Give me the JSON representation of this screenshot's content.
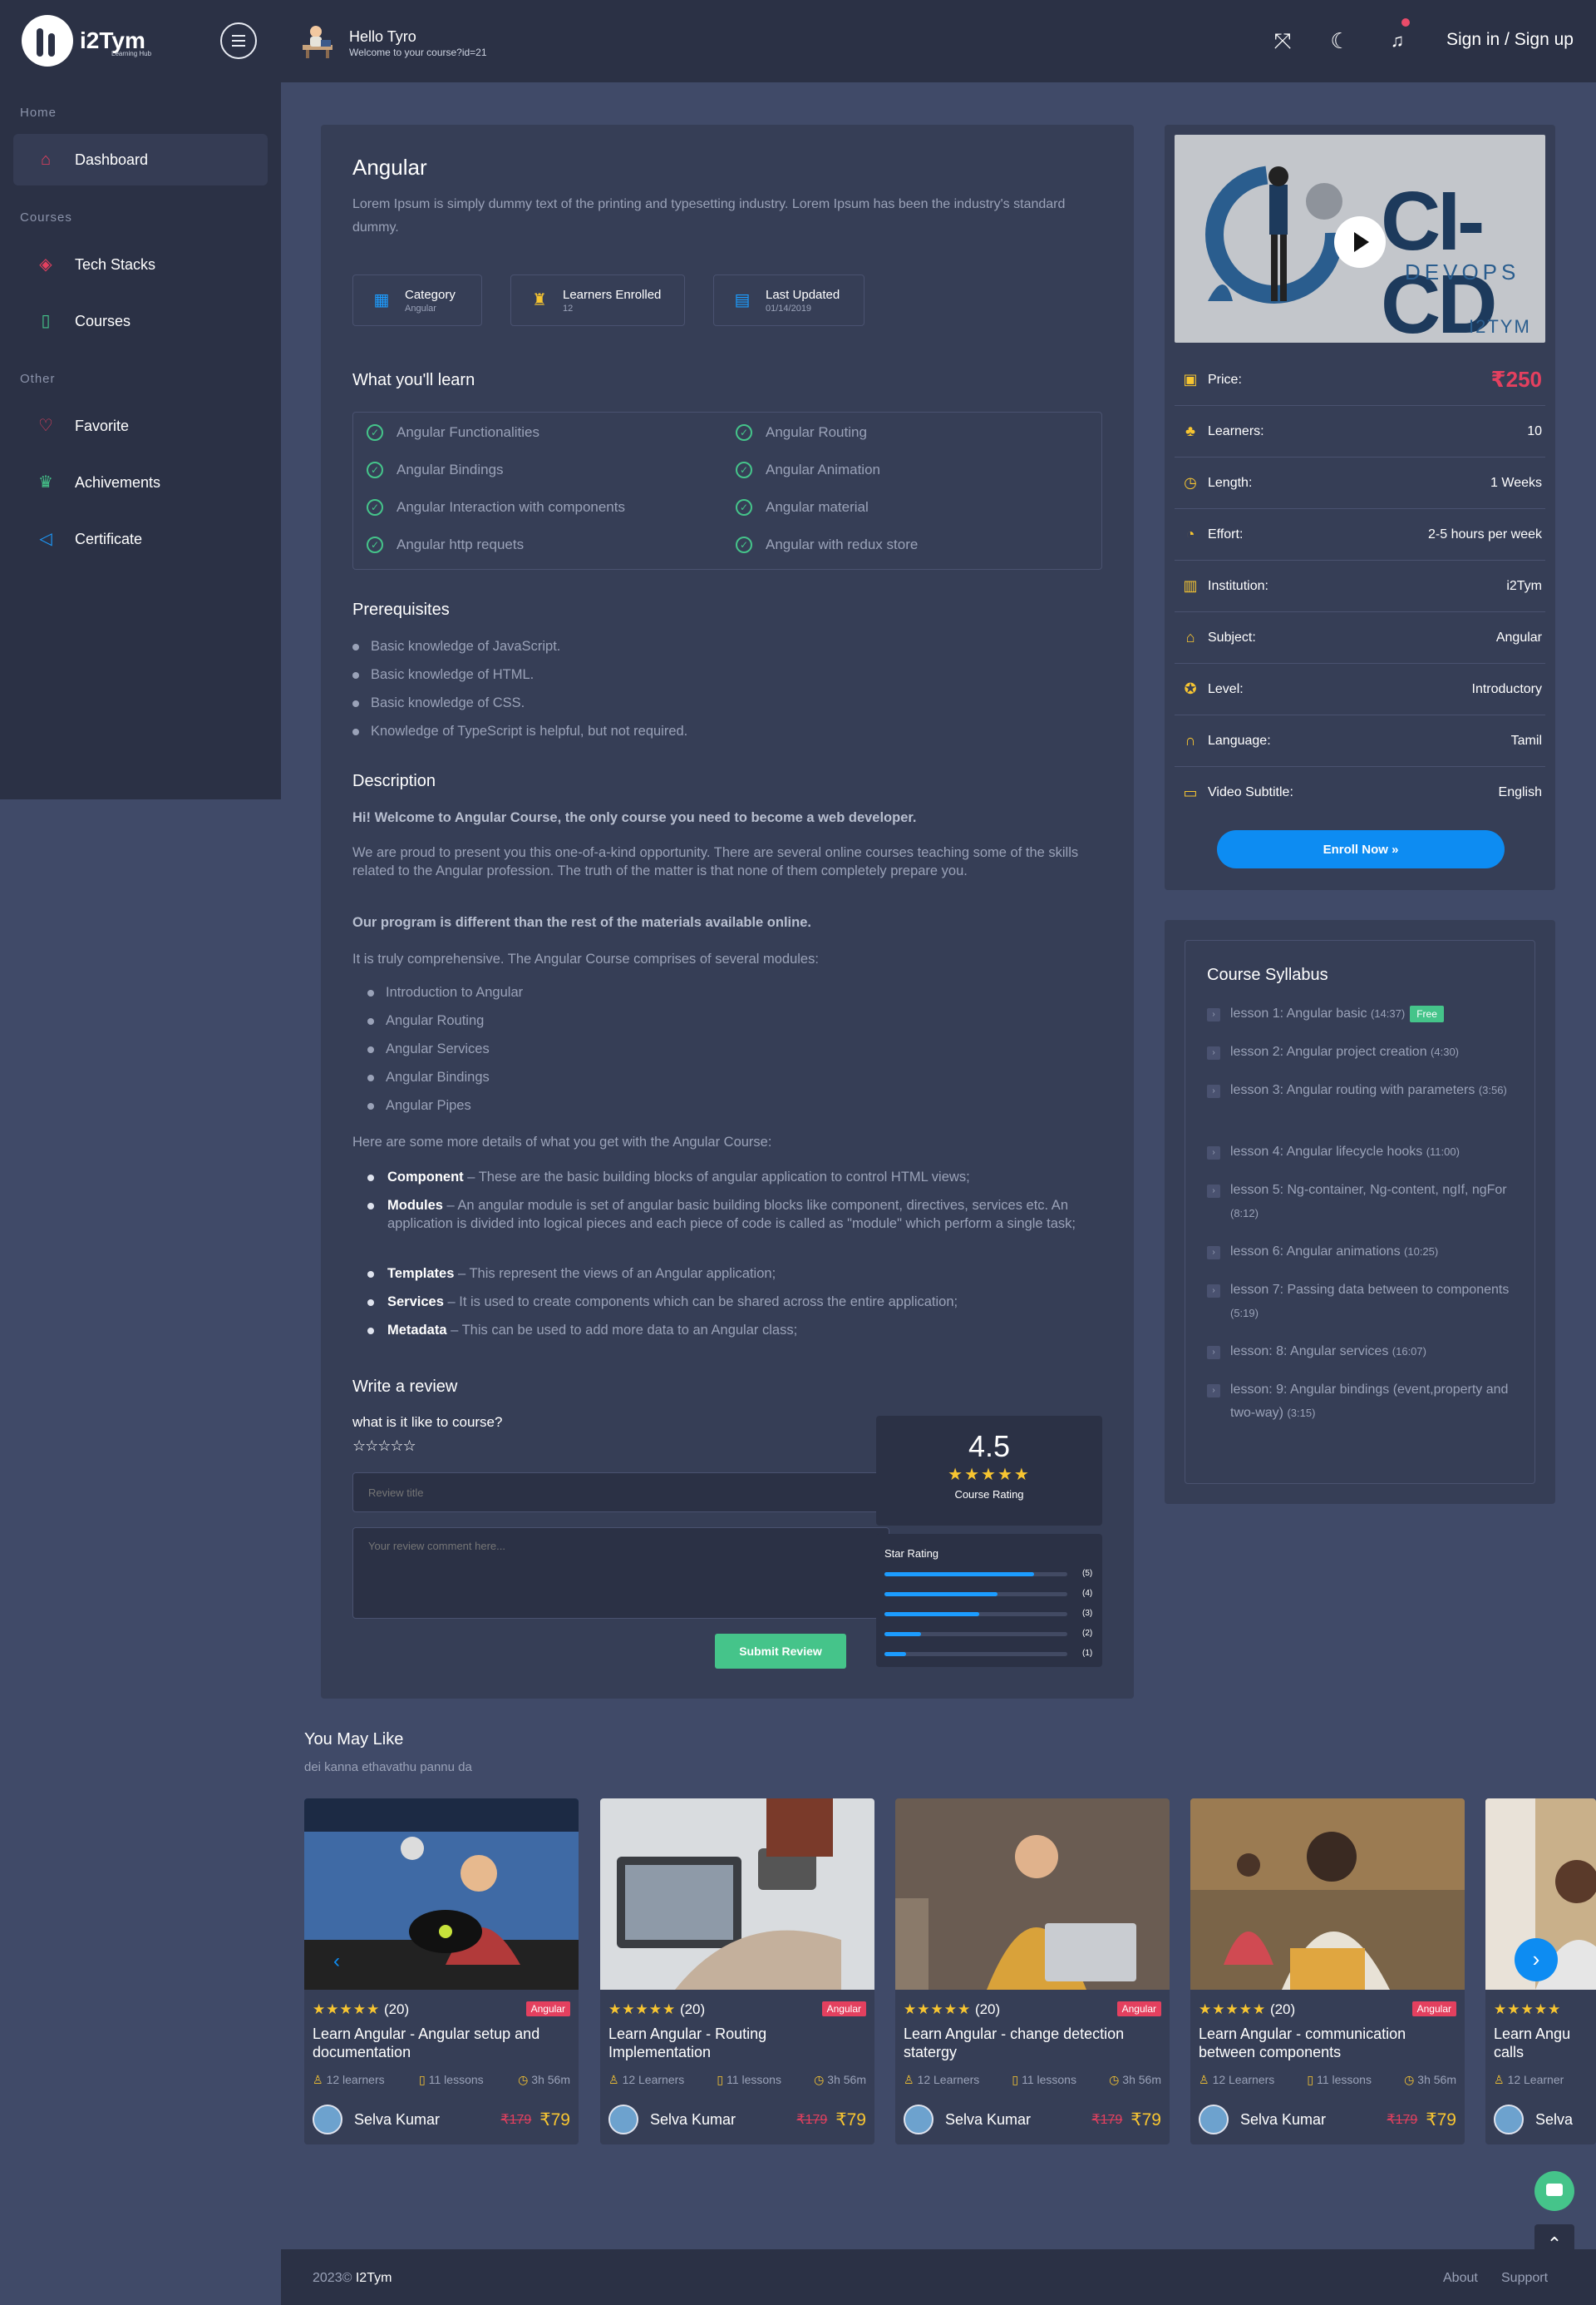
{
  "header": {
    "logo_text": "i2Tym",
    "logo_sub": "Learning Hub",
    "greeting_title": "Hello Tyro",
    "greeting_sub": "Welcome to your course?id=21",
    "signin_label": "Sign in / Sign up"
  },
  "sidebar": {
    "sections": [
      "Home",
      "Courses",
      "Other"
    ],
    "items": [
      {
        "label": "Dashboard",
        "icon": "home-icon",
        "color": "#e4405f"
      },
      {
        "label": "Tech Stacks",
        "icon": "cube-icon",
        "color": "#e4405f"
      },
      {
        "label": "Courses",
        "icon": "book-icon",
        "color": "#45c48a"
      },
      {
        "label": "Favorite",
        "icon": "heart-icon",
        "color": "#e4405f"
      },
      {
        "label": "Achivements",
        "icon": "trophy-icon",
        "color": "#45c48a"
      },
      {
        "label": "Certificate",
        "icon": "send-icon",
        "color": "#1c9cff"
      }
    ]
  },
  "course": {
    "title": "Angular",
    "intro": "Lorem Ipsum is simply dummy text of the printing and typesetting industry. Lorem Ipsum has been the industry's standard dummy.",
    "meta": [
      {
        "title": "Category",
        "value": "Angular"
      },
      {
        "title": "Learners Enrolled",
        "value": "12"
      },
      {
        "title": "Last Updated",
        "value": "01/14/2019"
      }
    ],
    "learn_heading": "What you'll learn",
    "learn_items": [
      "Angular Functionalities",
      "Angular Routing",
      "Angular Bindings",
      "Angular Animation",
      "Angular Interaction with components",
      "Angular material",
      "Angular http requets",
      "Angular with redux store"
    ],
    "prereq_heading": "Prerequisites",
    "prereqs": [
      "Basic knowledge of JavaScript.",
      "Basic knowledge of HTML.",
      "Basic knowledge of CSS.",
      "Knowledge of TypeScript is helpful, but not required."
    ],
    "desc_heading": "Description",
    "desc_welcome": "Hi! Welcome to Angular Course, the only course you need to become a web developer.",
    "desc_p1": "We are proud to present you this one-of-a-kind opportunity. There are several online courses teaching some of the skills related to the Angular profession. The truth of the matter is that none of them completely prepare you.",
    "desc_bold2": "Our program is different than the rest of the materials available online.",
    "desc_p2": "It is truly comprehensive. The Angular Course comprises of several modules:",
    "modules": [
      "Introduction to Angular",
      "Angular Routing",
      "Angular Services",
      "Angular Bindings",
      "Angular Pipes"
    ],
    "desc_p3": "Here are some more details of what you get with the Angular Course:",
    "details": [
      {
        "term": "Component",
        "text": " – These are the basic building blocks of angular application to control HTML views;"
      },
      {
        "term": "Modules",
        "text": " – An angular module is set of angular basic building blocks like component, directives, services etc. An application is divided into logical pieces and each piece of code is called as \"module\" which perform a single task;"
      },
      {
        "term": "Templates",
        "text": " – This represent the views of an Angular application;"
      },
      {
        "term": "Services",
        "text": " – It is used to create components which can be shared across the entire application;"
      },
      {
        "term": "Metadata",
        "text": " – This can be used to add more data to an Angular class;"
      }
    ]
  },
  "review": {
    "heading": "Write a review",
    "question": "what is it like to course?",
    "stars": "☆☆☆☆☆",
    "title_placeholder": "Review title",
    "comment_placeholder": "Your review comment here...",
    "submit_label": "Submit Review",
    "rating": "4.5",
    "rating_stars": "★★★★★",
    "rating_label": "Course Rating",
    "star_rating_label": "Star Rating",
    "bars": [
      {
        "label": "(5)",
        "fraction": 0.82
      },
      {
        "label": "(4)",
        "fraction": 0.62
      },
      {
        "label": "(3)",
        "fraction": 0.52
      },
      {
        "label": "(2)",
        "fraction": 0.2
      },
      {
        "label": "(1)",
        "fraction": 0.12
      }
    ]
  },
  "info": {
    "thumb_title": "CI-CD",
    "thumb_sub": "DEVOPS",
    "thumb_brand": "I2TYM",
    "rows": [
      {
        "label": "Price:",
        "value": "₹250",
        "icon": "money-icon"
      },
      {
        "label": "Learners:",
        "value": "10",
        "icon": "users-icon"
      },
      {
        "label": "Length:",
        "value": "1 Weeks",
        "icon": "clock-icon"
      },
      {
        "label": "Effort:",
        "value": "2-5 hours per week",
        "icon": "gauge-icon"
      },
      {
        "label": "Institution:",
        "value": "i2Tym",
        "icon": "building-icon"
      },
      {
        "label": "Subject:",
        "value": "Angular",
        "icon": "graduation-cap-icon"
      },
      {
        "label": "Level:",
        "value": "Introductory",
        "icon": "badge-icon"
      },
      {
        "label": "Language:",
        "value": "Tamil",
        "icon": "headphones-icon"
      },
      {
        "label": "Video Subtitle:",
        "value": "English",
        "icon": "subtitle-icon"
      }
    ],
    "enroll_label": "Enroll Now »"
  },
  "syllabus": {
    "title": "Course Syllabus",
    "lessons": [
      {
        "name": "lesson 1: Angular basic",
        "dur": "(14:37)",
        "free": "Free"
      },
      {
        "name": "lesson 2: Angular project creation",
        "dur": "(4:30)"
      },
      {
        "name": "lesson 3: Angular routing with parameters",
        "dur": "(3:56)"
      },
      {
        "name": "lesson 4: Angular lifecycle hooks",
        "dur": "(11:00)"
      },
      {
        "name": "lesson 5: Ng-container, Ng-content, ngIf, ngFor",
        "dur": "(8:12)"
      },
      {
        "name": "lesson 6: Angular animations",
        "dur": "(10:25)"
      },
      {
        "name": "lesson 7: Passing data between to components",
        "dur": "(5:19)"
      },
      {
        "name": "lesson: 8: Angular services",
        "dur": "(16:07)"
      },
      {
        "name": "lesson: 9: Angular bindings (event,property and two-way)",
        "dur": "(3:15)"
      }
    ]
  },
  "you_may_like": {
    "title": "You May Like",
    "subtitle": "dei kanna ethavathu pannu da",
    "cards": [
      {
        "stars": "★★★★★",
        "count": "(20)",
        "tag": "Angular",
        "title": "Learn Angular - Angular setup and documentation",
        "learners": "12 learners",
        "lessons": "11 lessons",
        "duration": "3h 56m",
        "author": "Selva Kumar",
        "old_price": "₹179",
        "price": "₹79"
      },
      {
        "stars": "★★★★★",
        "count": "(20)",
        "tag": "Angular",
        "title": "Learn Angular - Routing Implementation",
        "learners": "12 Learners",
        "lessons": "11 lessons",
        "duration": "3h 56m",
        "author": "Selva Kumar",
        "old_price": "₹179",
        "price": "₹79"
      },
      {
        "stars": "★★★★★",
        "count": "(20)",
        "tag": "Angular",
        "title": "Learn Angular - change detection statergy",
        "learners": "12 Learners",
        "lessons": "11 lessons",
        "duration": "3h 56m",
        "author": "Selva Kumar",
        "old_price": "₹179",
        "price": "₹79"
      },
      {
        "stars": "★★★★★",
        "count": "(20)",
        "tag": "Angular",
        "title": "Learn Angular - communication between components",
        "learners": "12 Learners",
        "lessons": "11 lessons",
        "duration": "3h 56m",
        "author": "Selva Kumar",
        "old_price": "₹179",
        "price": "₹79"
      },
      {
        "stars": "★★★★★",
        "count": "",
        "tag": "",
        "title": "Learn Angu calls",
        "learners": "12 Learner",
        "lessons": "",
        "duration": "",
        "author": "Selva",
        "old_price": "",
        "price": ""
      }
    ]
  },
  "footer": {
    "copyright": "2023©",
    "brand": "I2Tym",
    "links": [
      "About",
      "Support"
    ]
  }
}
